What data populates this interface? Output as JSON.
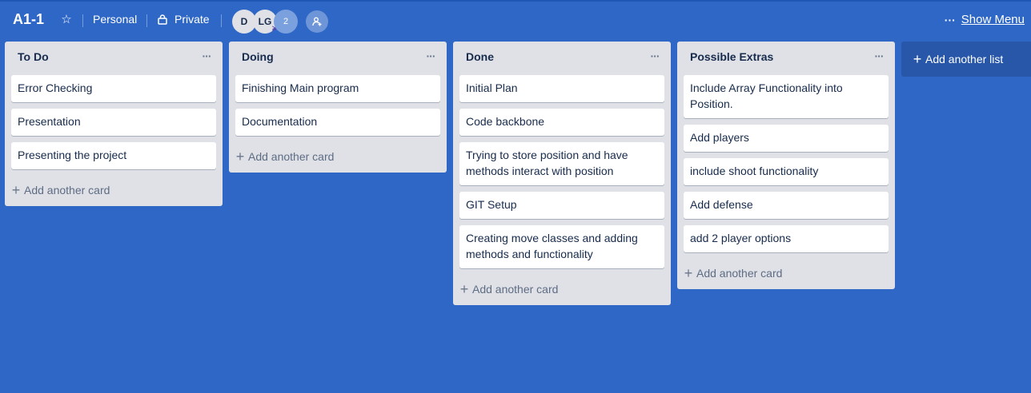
{
  "board": {
    "title": "A1-1",
    "team": "Personal",
    "visibility": "Private",
    "members": [
      {
        "initials": "D"
      },
      {
        "initials": "LG"
      }
    ],
    "extra_members": "2",
    "show_menu": "Show Menu"
  },
  "lists": [
    {
      "title": "To Do",
      "cards": [
        "Error Checking",
        "Presentation",
        "Presenting the project"
      ],
      "add_card": "Add another card"
    },
    {
      "title": "Doing",
      "cards": [
        "Finishing Main program",
        "Documentation"
      ],
      "add_card": "Add another card"
    },
    {
      "title": "Done",
      "cards": [
        "Initial Plan",
        "Code backbone",
        "Trying to store position and have methods interact with position",
        "GIT Setup",
        "Creating move classes and adding methods and functionality"
      ],
      "add_card": "Add another card"
    },
    {
      "title": "Possible Extras",
      "cards": [
        "Include Array Functionality into Position.",
        "Add players",
        "include shoot functionality",
        "Add defense",
        "add 2 player options"
      ],
      "add_card": "Add another card"
    }
  ],
  "add_list": "Add another list",
  "colors": {
    "board_background": "#2f67c7",
    "list_background": "#dfe1e6",
    "card_background": "#ffffff"
  }
}
